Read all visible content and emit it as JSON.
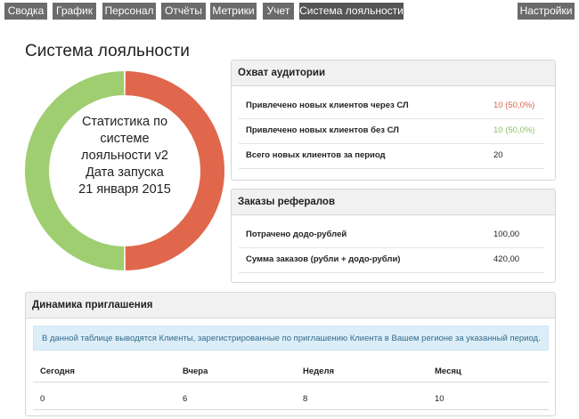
{
  "nav": {
    "tabs": [
      "Сводка",
      "График",
      "Персонал",
      "Отчёты",
      "Метрики",
      "Учет",
      "Система лояльности"
    ],
    "settings": "Настройки"
  },
  "page": {
    "title": "Система лояльности"
  },
  "donut": {
    "lines": [
      "Статистика по",
      "системе",
      "лояльности v2",
      "Дата запуска",
      "21 января 2015"
    ],
    "share_via_sl": 0.5,
    "share_without_sl": 0.5,
    "colors": {
      "via_sl": "#e0674b",
      "without_sl": "#9fce71"
    }
  },
  "audience": {
    "title": "Охват аудитории",
    "rows": [
      {
        "label": "Привлечено новых клиентов через СЛ",
        "value": "10 (50,0%)"
      },
      {
        "label": "Привлечено новых клиентов без СЛ",
        "value": "10 (50,0%)"
      },
      {
        "label": "Всего новых клиентов за период",
        "value": "20"
      }
    ]
  },
  "referrals": {
    "title": "Заказы рефералов",
    "rows": [
      {
        "label": "Потрачено додо-рублей",
        "value": "100,00"
      },
      {
        "label": "Сумма заказов (рубли + додо-рубли)",
        "value": "420,00"
      }
    ]
  },
  "dynamics": {
    "title": "Динамика приглашения",
    "info": "В данной таблице выводятся Клиенты, зарегистрированные по приглашению Клиента в Вашем регионе за указанный период.",
    "columns": [
      "Сегодня",
      "Вчера",
      "Неделя",
      "Месяц"
    ],
    "values": [
      "0",
      "6",
      "8",
      "10"
    ]
  }
}
